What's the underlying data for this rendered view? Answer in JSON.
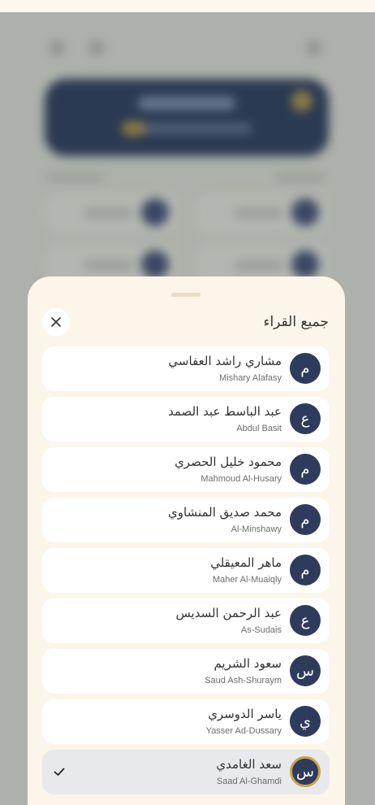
{
  "sheet": {
    "title": "جميع القراء",
    "close_icon": "close-icon"
  },
  "reciters": [
    {
      "initial": "م",
      "name_ar": "مشاري راشد العفاسي",
      "name_en": "Mishary Alafasy",
      "selected": false
    },
    {
      "initial": "ع",
      "name_ar": "عبد الباسط عبد الصمد",
      "name_en": "Abdul Basit",
      "selected": false
    },
    {
      "initial": "م",
      "name_ar": "محمود خليل الحصري",
      "name_en": "Mahmoud Al-Husary",
      "selected": false
    },
    {
      "initial": "م",
      "name_ar": "محمد صديق المنشاوي",
      "name_en": "Al-Minshawy",
      "selected": false
    },
    {
      "initial": "م",
      "name_ar": "ماهر المعيقلي",
      "name_en": "Maher Al-Muaiqly",
      "selected": false
    },
    {
      "initial": "ع",
      "name_ar": "عبد الرحمن السديس",
      "name_en": "As-Sudais",
      "selected": false
    },
    {
      "initial": "س",
      "name_ar": "سعود الشريم",
      "name_en": "Saud Ash-Shuraym",
      "selected": false
    },
    {
      "initial": "ي",
      "name_ar": "ياسر الدوسري",
      "name_en": "Yasser Ad-Dussary",
      "selected": false
    },
    {
      "initial": "س",
      "name_ar": "سعد الغامدي",
      "name_en": "Saad Al-Ghamdi",
      "selected": true
    }
  ],
  "colors": {
    "avatar_bg": "#2e3b5c",
    "selected_ring": "#c9a24a",
    "sheet_bg": "#fcf5e9",
    "selected_row": "#e8e9ec"
  }
}
